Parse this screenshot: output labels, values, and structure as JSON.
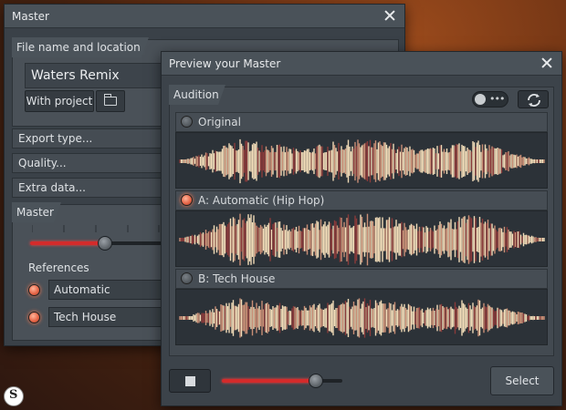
{
  "master": {
    "title": "Master",
    "file_section": "File name and location",
    "file_name": "Waters Remix",
    "with_project_label": "With project",
    "export_type_label": "Export type...",
    "quality_label": "Quality...",
    "extra_data_label": "Extra data...",
    "master_section": "Master",
    "slider_value": 0.57,
    "references_label": "References",
    "references": [
      {
        "name": "Automatic",
        "active": true
      },
      {
        "name": "Tech House",
        "active": true
      }
    ]
  },
  "preview": {
    "title": "Preview your Master",
    "audition_label": "Audition",
    "tracks": [
      {
        "label": "Original",
        "selected": false
      },
      {
        "label": "A: Automatic (Hip Hop)",
        "selected": true
      },
      {
        "label": "B: Tech House",
        "selected": false
      }
    ],
    "volume_value": 0.78,
    "select_label": "Select"
  },
  "logo_text": "S",
  "colors": {
    "accent_red": "#d42b2b",
    "radio_on": "#e8684a",
    "wave_light": "#f1dcb8",
    "wave_dark": "#8a3a3a"
  },
  "icons": [
    "close-icon",
    "folder-icon",
    "stop-icon",
    "refresh-icon",
    "toggle-icon"
  ]
}
